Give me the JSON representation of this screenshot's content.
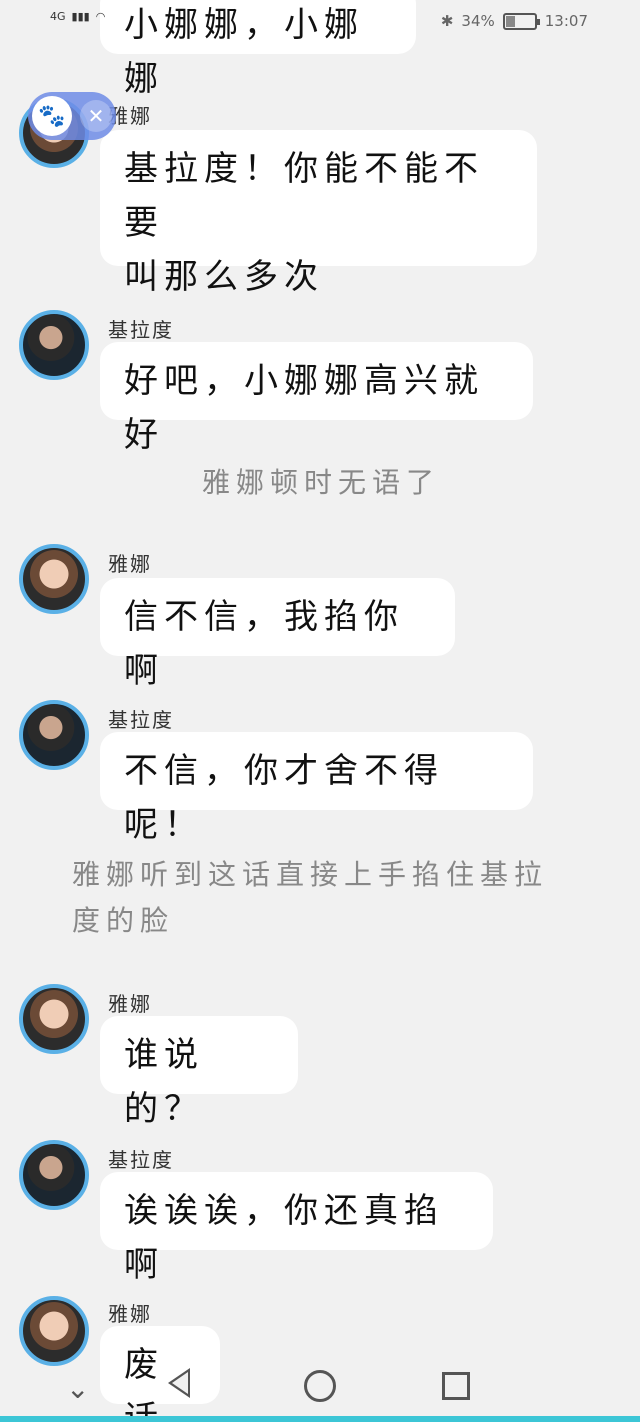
{
  "status_bar": {
    "network": "4G",
    "battery_percent": "34%",
    "battery_level": 0.34,
    "time": "13:07"
  },
  "messages": [
    {
      "type": "bubble",
      "speaker": "",
      "text": "小娜娜，小娜娜"
    },
    {
      "type": "bubble",
      "speaker": "雅娜",
      "text_lines": [
        "基拉度！你能不能不要",
        "叫那么多次"
      ]
    },
    {
      "type": "bubble",
      "speaker": "基拉度",
      "text": "好吧，小娜娜高兴就好"
    },
    {
      "type": "narration",
      "text": "雅娜顿时无语了"
    },
    {
      "type": "bubble",
      "speaker": "雅娜",
      "text": "信不信，我掐你啊"
    },
    {
      "type": "bubble",
      "speaker": "基拉度",
      "text": "不信，你才舍不得呢！"
    },
    {
      "type": "narration",
      "text_lines": [
        "雅娜听到这话直接上手掐住基拉",
        "度的脸"
      ]
    },
    {
      "type": "bubble",
      "speaker": "雅娜",
      "text": "谁说的？"
    },
    {
      "type": "bubble",
      "speaker": "基拉度",
      "text": "诶诶诶，你还真掐啊"
    },
    {
      "type": "bubble",
      "speaker": "雅娜",
      "text": "废话"
    }
  ],
  "floating_widget": {
    "icon": "paw-icon",
    "close_icon": "close-icon",
    "close_glyph": "✕",
    "paw_glyph": "🐾"
  },
  "navbar": {
    "down_icon": "chevron-down-icon",
    "down_glyph": "⌄"
  }
}
